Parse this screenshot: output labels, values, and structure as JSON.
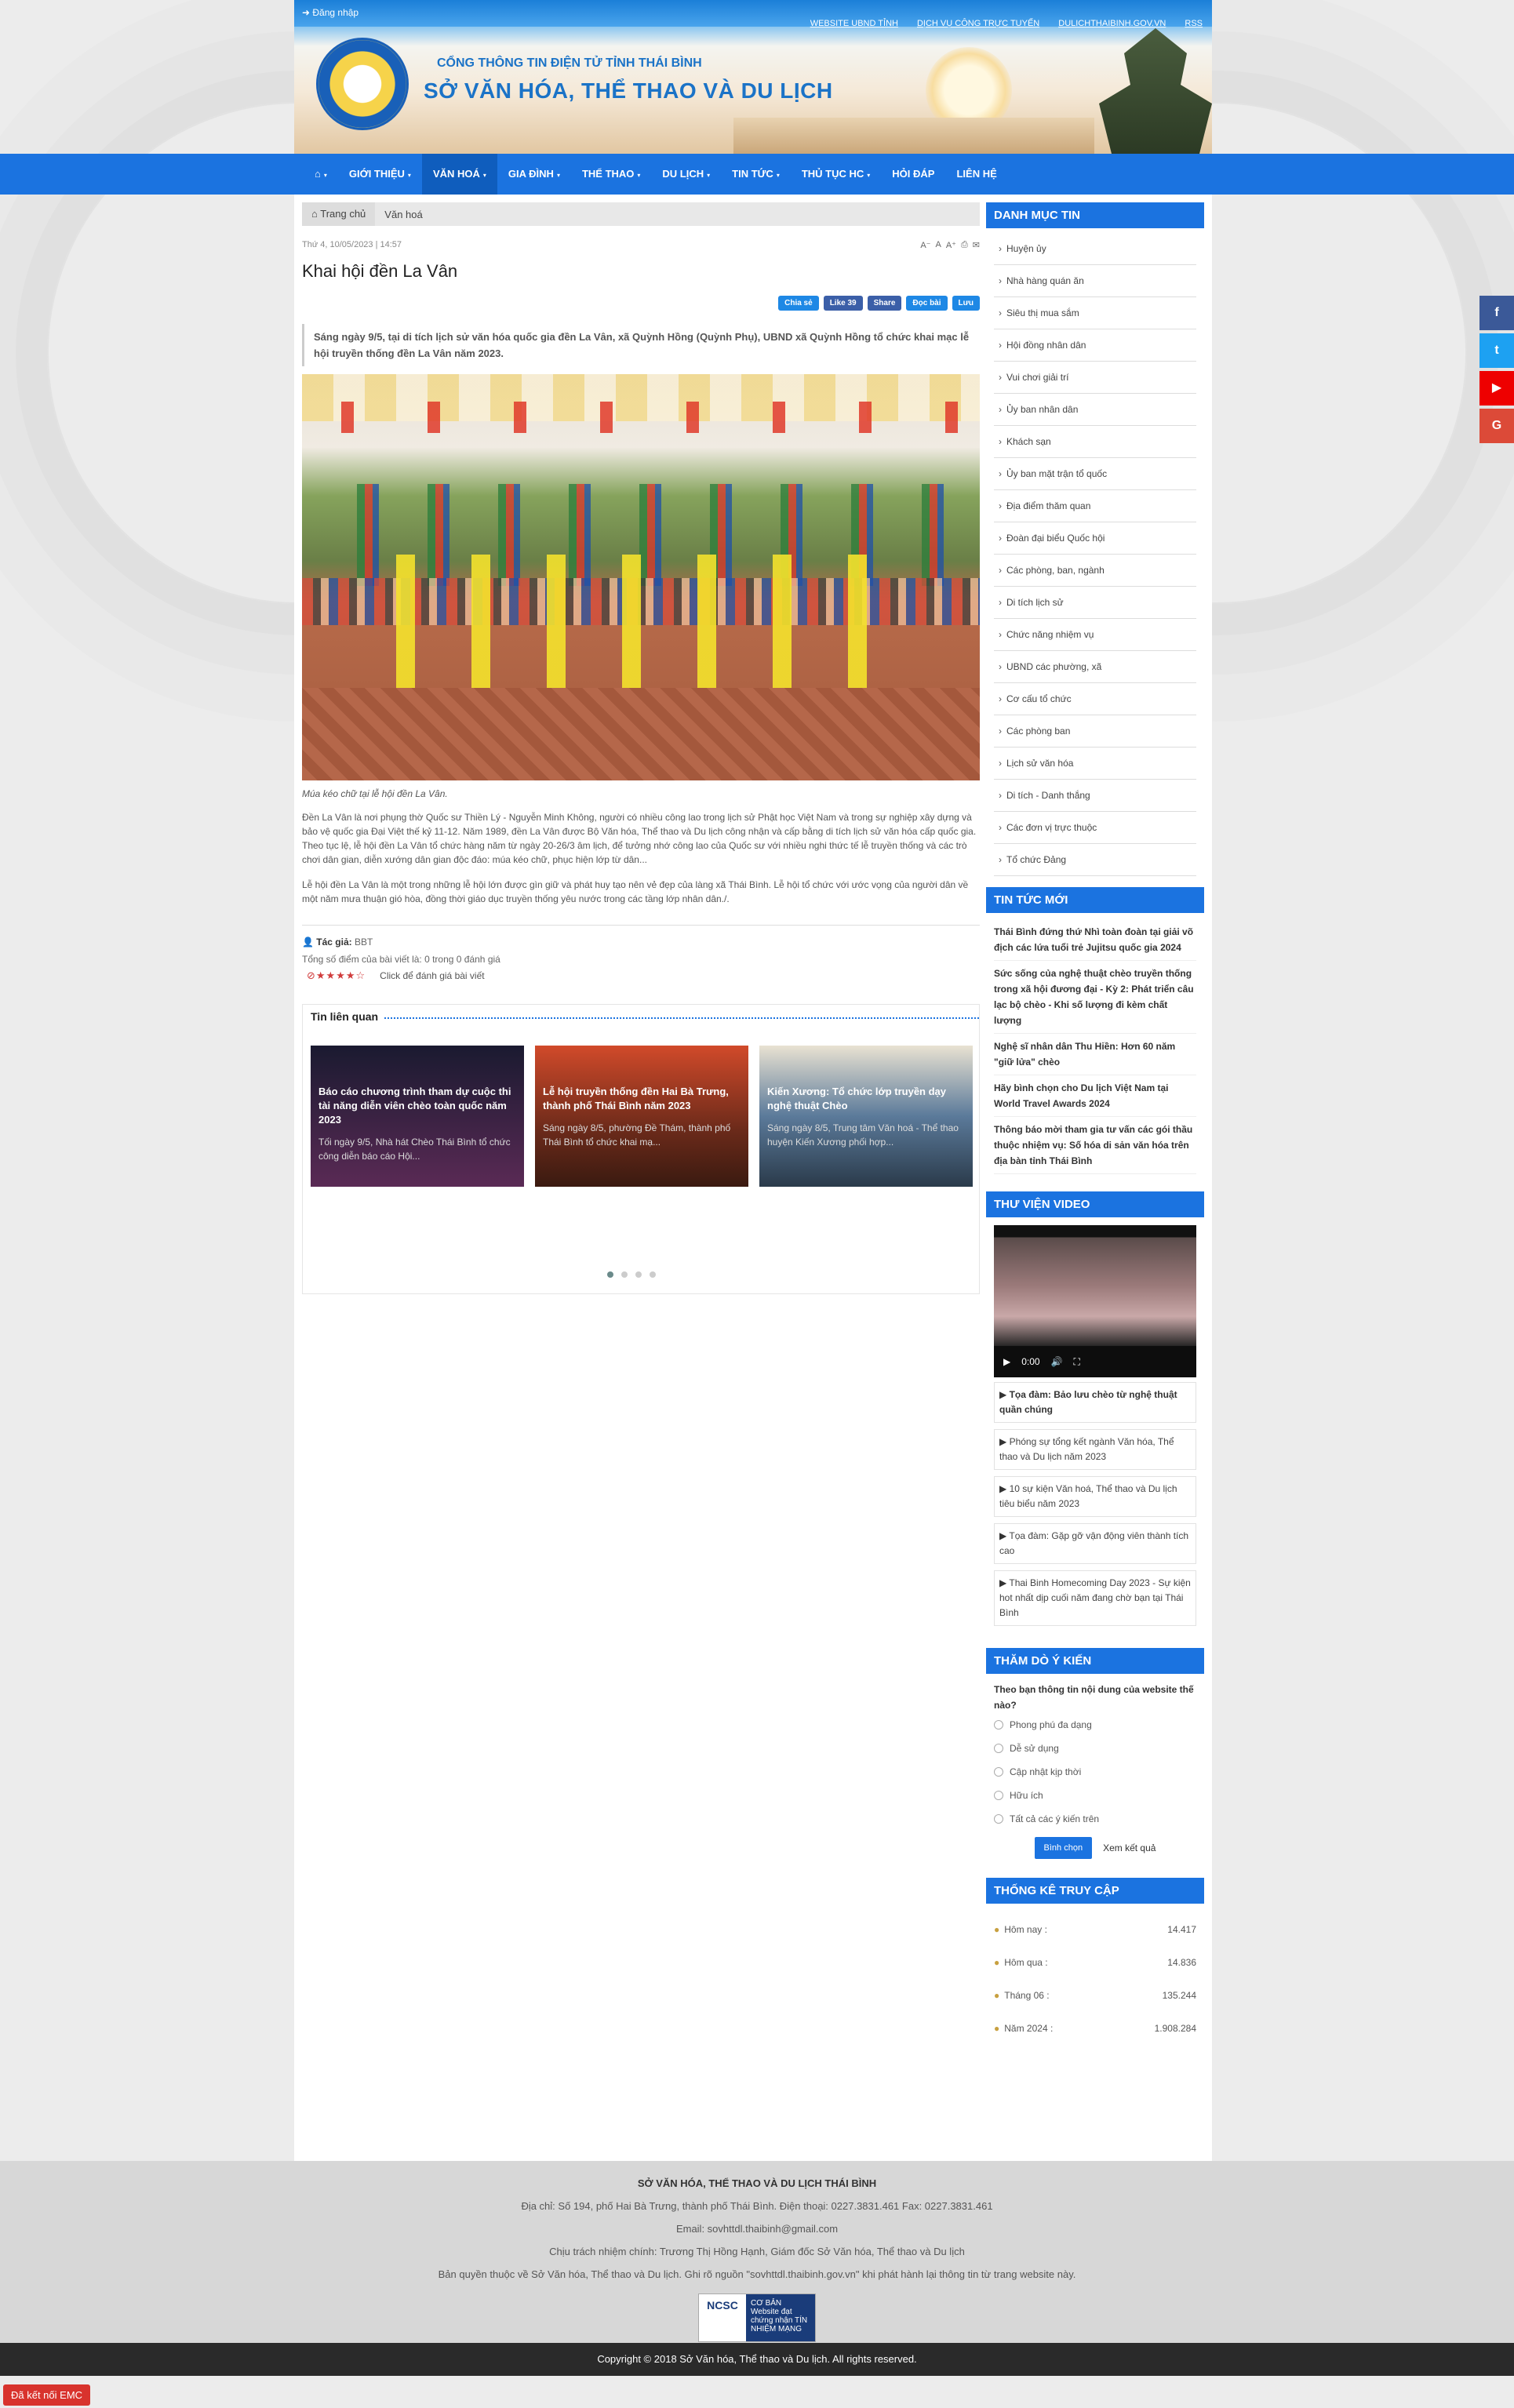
{
  "header": {
    "login": "Đăng nhập",
    "top_links": [
      "WEBSITE UBND TỈNH",
      "DỊCH VỤ CÔNG TRỰC TUYẾN",
      "DULICHTHAIBINH.GOV.VN",
      "RSS"
    ],
    "portal": "CỔNG THÔNG TIN ĐIỆN TỬ TỈNH THÁI BÌNH",
    "dept": "SỞ VĂN HÓA, THỂ THAO VÀ DU LỊCH"
  },
  "nav": {
    "items": [
      "GIỚI THIỆU",
      "VĂN HOÁ",
      "GIA ĐÌNH",
      "THỂ THAO",
      "DU LỊCH",
      "TIN TỨC",
      "THỦ TỤC HC",
      "HỎI ĐÁP",
      "LIÊN HỆ"
    ]
  },
  "breadcrumb": [
    "Trang chủ",
    "Văn hoá"
  ],
  "article": {
    "date": "Thứ 4, 10/05/2023 | 14:57",
    "title": "Khai hội đền La Vân",
    "share": {
      "chia_se": "Chia sẻ",
      "like": "Like 39",
      "share": "Share",
      "doc_bai": "Đọc bài",
      "luu": "Lưu"
    },
    "lead": "Sáng ngày 9/5, tại di tích lịch sử văn hóa quốc gia đền La Vân, xã Quỳnh Hồng (Quỳnh Phụ), UBND xã Quỳnh Hồng tổ chức khai mạc lễ hội truyền thống đền La Vân năm 2023.",
    "caption": "Múa kéo chữ tại lễ hội đền La Vân.",
    "para1": "Đền La Vân là nơi phụng thờ Quốc sư Thiền Lý - Nguyễn Minh Không, người có nhiều công lao trong lịch sử Phật học Việt Nam và trong sự nghiệp xây dựng và bảo vệ quốc gia Đại Việt thế kỷ 11-12. Năm 1989, đền La Vân được Bộ Văn hóa, Thể thao và Du lịch công nhận và cấp bằng di tích lịch sử văn hóa cấp quốc gia. Theo tục lệ, lễ hội đền La Vân tổ chức hàng năm từ ngày 20-26/3 âm lịch, để tưởng nhớ công lao của Quốc sư với nhiều nghi thức tế lễ truyền thống và các trò chơi dân gian, diễn xướng dân gian độc đáo: múa kéo chữ, phục hiện lớp từ dân...",
    "para2": "Lễ hội đền La Vân là một trong những lễ hội lớn được gìn giữ và phát huy tạo nên vẻ đẹp của làng xã Thái Bình. Lễ hội tổ chức với ước vọng của người dân về một năm mưa thuận gió hòa, đồng thời giáo dục truyền thống yêu nước trong các tầng lớp nhân dân./.",
    "author_label": "Tác giả:",
    "author": "BBT",
    "rating_total": "Tổng số điểm của bài viết là: 0 trong 0 đánh giá",
    "rating_click": "Click để đánh giá bài viết"
  },
  "related": {
    "heading": "Tin liên quan",
    "cards": [
      {
        "title": "Báo cáo chương trình tham dự cuộc thi tài năng diễn viên chèo toàn quốc năm 2023",
        "desc": "Tối ngày 9/5, Nhà hát Chèo Thái Bình tổ chức công diễn báo cáo Hội..."
      },
      {
        "title": "Lễ hội truyền thống đền Hai Bà Trưng, thành phố Thái Bình năm 2023",
        "desc": "Sáng ngày 8/5, phường Đề Thám, thành phố Thái Bình tổ chức khai mạ..."
      },
      {
        "title": "Kiến Xương: Tổ chức lớp truyền dạy nghệ thuật Chèo",
        "desc": "Sáng ngày 8/5, Trung tâm Văn hoá - Thể thao huyện Kiến Xương phối hợp..."
      }
    ]
  },
  "sidebar": {
    "categories_title": "DANH MỤC TIN",
    "categories": [
      "Huyện ủy",
      "Nhà hàng quán ăn",
      "Siêu thị mua sắm",
      "Hội đồng nhân dân",
      "Vui chơi giải trí",
      "Ủy ban nhân dân",
      "Khách sạn",
      "Ủy ban mặt trận tổ quốc",
      "Địa điểm thăm quan",
      "Đoàn đại biểu Quốc hội",
      "Các phòng, ban, ngành",
      "Di tích lịch sử",
      "Chức năng nhiệm vụ",
      "UBND các phường, xã",
      "Cơ cấu tổ chức",
      "Các phòng ban",
      "Lịch sử văn hóa",
      "Di tích - Danh thắng",
      "Các đơn vị trực thuộc",
      "Tổ chức Đảng"
    ],
    "news_title": "TIN TỨC MỚI",
    "news": [
      "Thái Bình đứng thứ Nhì toàn đoàn tại giải võ địch các lứa tuổi trẻ Jujitsu quốc gia 2024",
      "Sức sống của nghệ thuật chèo truyền thống trong xã hội đương đại - Kỳ 2: Phát triển câu lạc bộ chèo - Khi số lượng đi kèm chất lượng",
      "Nghệ sĩ nhân dân Thu Hiền: Hơn 60 năm \"giữ lửa\" chèo",
      "Hãy bình chọn cho Du lịch Việt Nam tại World Travel Awards 2024",
      "Thông báo mời tham gia tư vấn các gói thầu thuộc nhiệm vụ: Số hóa di sản văn hóa trên địa bàn tỉnh Thái Bình"
    ],
    "video_title": "THƯ VIỆN VIDEO",
    "video_time": "0:00",
    "videos": [
      "Tọa đàm: Bảo lưu chèo từ nghệ thuật quần chúng",
      "Phóng sự tổng kết ngành Văn hóa, Thể thao và Du lịch năm 2023",
      "10 sự kiện Văn hoá, Thể thao và Du lịch tiêu biểu năm 2023",
      "Tọa đàm: Gặp gỡ vận động viên thành tích cao",
      "Thai Binh Homecoming Day 2023 - Sự kiện hot nhất dịp cuối năm đang chờ bạn tại Thái Bình"
    ],
    "poll_title": "THĂM DÒ Ý KIẾN",
    "poll_question": "Theo bạn thông tin nội dung của website thế nào?",
    "poll_options": [
      "Phong phú đa dạng",
      "Dễ sử dụng",
      "Cập nhật kịp thời",
      "Hữu ích",
      "Tất cả các ý kiến trên"
    ],
    "poll_vote": "Bình chọn",
    "poll_results": "Xem kết quả",
    "stats_title": "THỐNG KÊ TRUY CẬP",
    "stats": [
      {
        "label": "Hôm nay :",
        "value": "14.417"
      },
      {
        "label": "Hôm qua :",
        "value": "14.836"
      },
      {
        "label": "Tháng 06 :",
        "value": "135.244"
      },
      {
        "label": "Năm 2024 :",
        "value": "1.908.284"
      }
    ]
  },
  "footer": {
    "org": "SỞ VĂN HÓA, THỂ THAO VÀ DU LỊCH THÁI BÌNH",
    "address": "Địa chỉ: Số 194, phố Hai Bà Trưng, thành phố Thái Bình. Điện thoại: 0227.3831.461 Fax: 0227.3831.461",
    "email": "Email: sovhttdl.thaibinh@gmail.com",
    "responsible": "Chịu trách nhiệm chính: Trương Thị Hồng Hạnh, Giám đốc Sở Văn hóa, Thể thao và Du lịch",
    "copyright_note": "Bản quyền thuộc về Sở Văn hóa, Thể thao và Du lịch. Ghi rõ nguồn \"sovhttdl.thaibinh.gov.vn\" khi phát hành lại thông tin từ trang website này.",
    "ncsc_left": "NCSC",
    "ncsc_level": "CƠ BẢN",
    "ncsc_text": "Website đạt chứng nhận TÍN NHIỆM MẠNG",
    "copyright": "Copyright © 2018 Sở Văn hóa, Thể thao và Du lịch. All rights reserved."
  },
  "emc": "Đã kết nối EMC"
}
